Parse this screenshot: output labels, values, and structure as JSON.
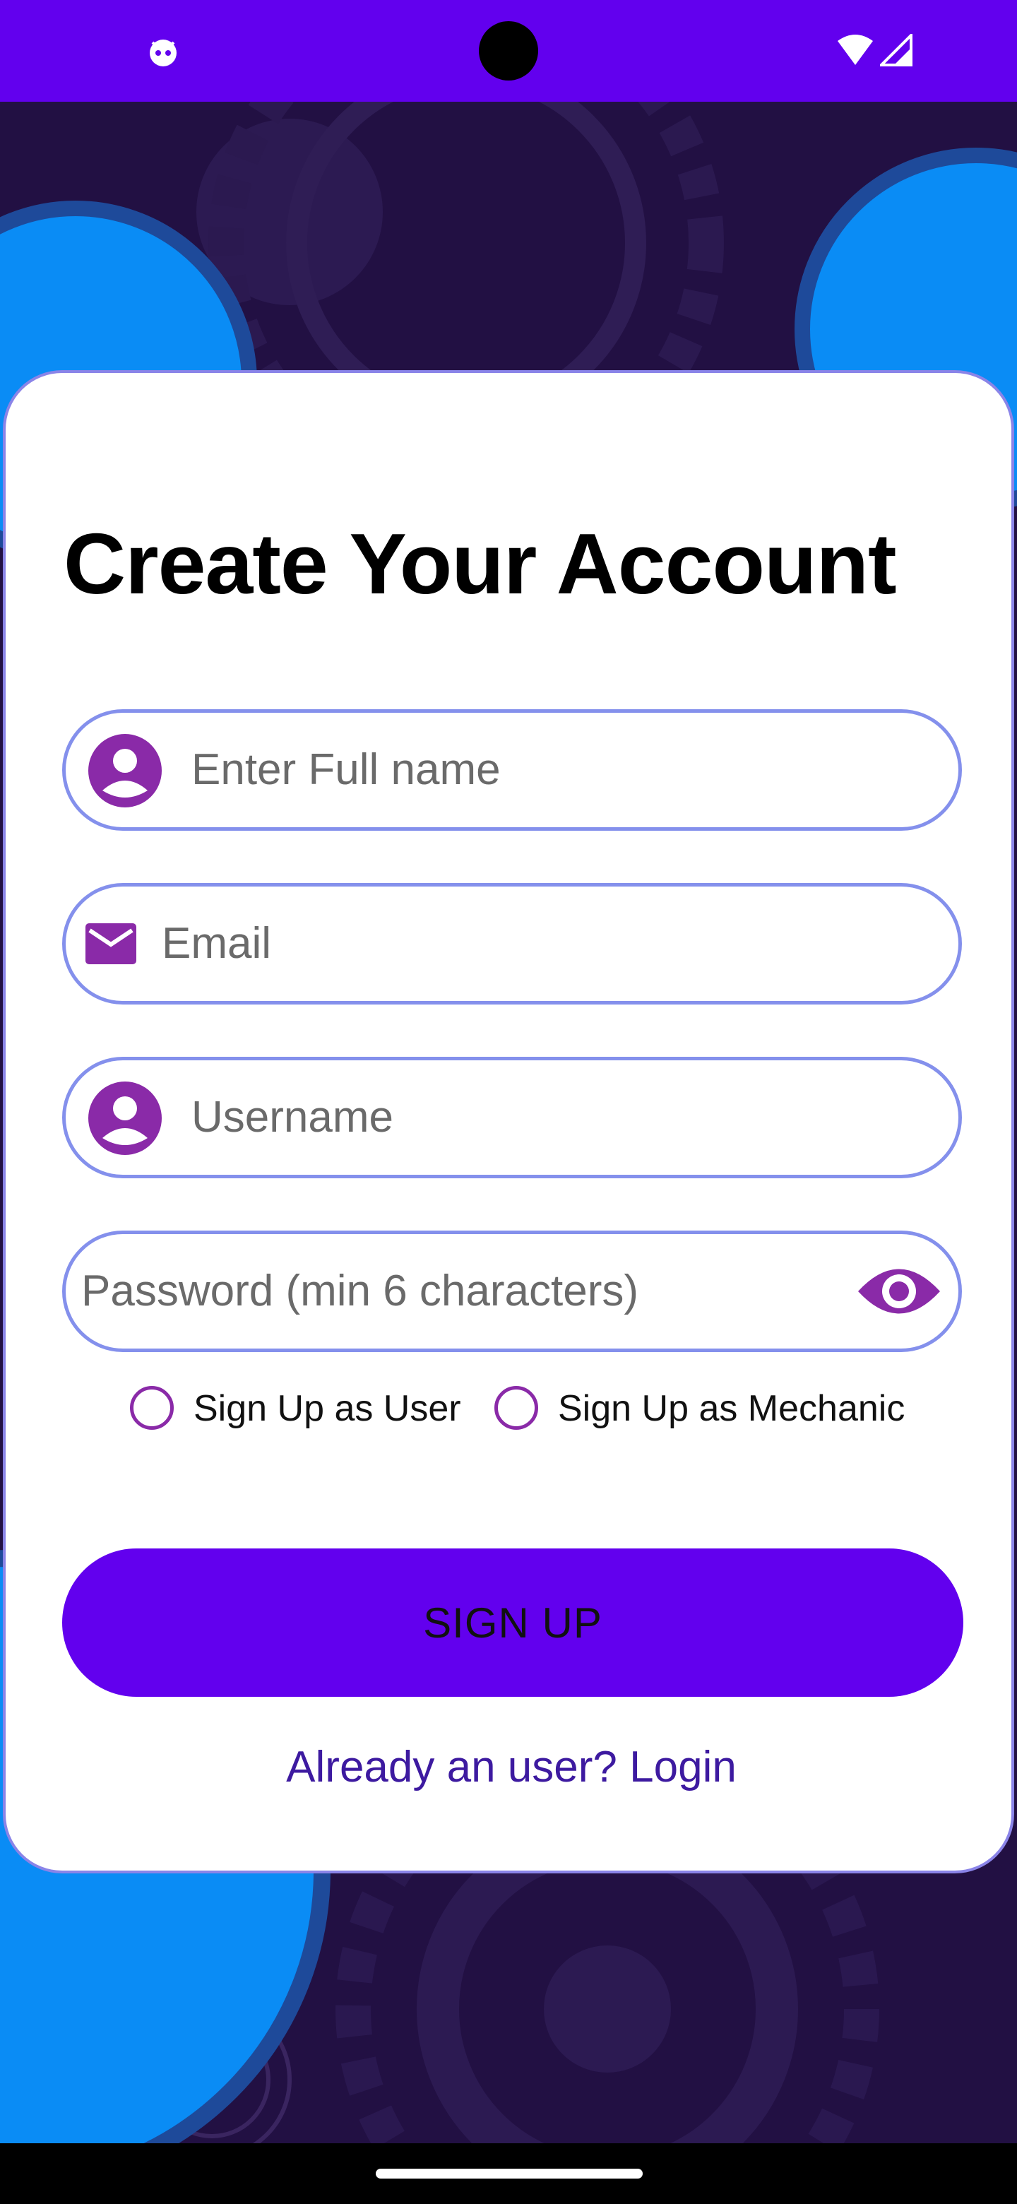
{
  "colors": {
    "primary": "#6200ee",
    "accent_icon": "#8a2aa8",
    "field_border": "#8490ec",
    "background": "#221043",
    "bubble": "#0a8cf5",
    "link": "#3d1aa0"
  },
  "form": {
    "title": "Create Your Account",
    "full_name": {
      "placeholder": "Enter Full name",
      "icon": "person-icon"
    },
    "email": {
      "placeholder": "Email",
      "icon": "mail-icon"
    },
    "username": {
      "placeholder": "Username",
      "icon": "person-icon"
    },
    "password": {
      "placeholder": "Password (min 6 characters)",
      "toggle_icon": "eye-icon"
    },
    "roles": [
      {
        "label": "Sign Up as User",
        "selected": false
      },
      {
        "label": "Sign Up as Mechanic",
        "selected": false
      }
    ],
    "submit_label": "SIGN UP",
    "login_link": "Already an user? Login"
  }
}
